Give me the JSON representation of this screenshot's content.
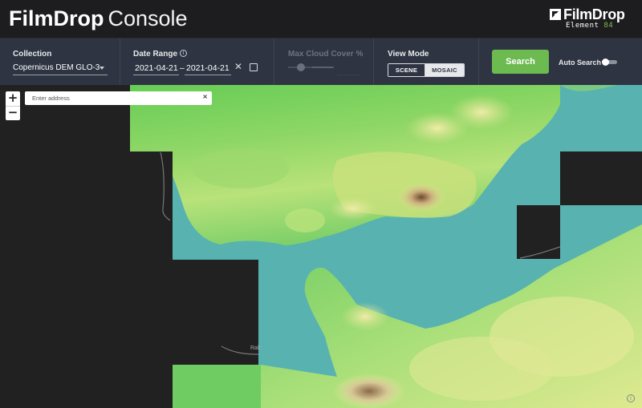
{
  "header": {
    "title_bold": "FilmDrop",
    "title_light": "Console",
    "brand_name": "FilmDrop",
    "brand_sub_word": "Element",
    "brand_sub_num": "84"
  },
  "toolbar": {
    "collection": {
      "label": "Collection",
      "value": "Copernicus DEM GLO-3"
    },
    "date_range": {
      "label": "Date Range",
      "start": "2021-04-21",
      "separator": "–",
      "end": "2021-04-21"
    },
    "cloud_cover": {
      "label": "Max Cloud Cover %",
      "disabled": true
    },
    "view_mode": {
      "label": "View Mode",
      "options": [
        "SCENE",
        "MOSAIC"
      ],
      "selected": "MOSAIC"
    },
    "search_label": "Search",
    "auto_search": {
      "label": "Auto Search",
      "enabled": false
    }
  },
  "map": {
    "zoom_in": "+",
    "zoom_out": "−",
    "address_placeholder": "Enter address",
    "address_clear": "×",
    "place_label": "Rab",
    "info_glyph": "i"
  },
  "colors": {
    "header_bg": "#1d1d1f",
    "toolbar_bg": "#2e3442",
    "accent_green": "#6cba50",
    "sea": "#58b2b0",
    "no_data": "#212121"
  },
  "icons": [
    "info-icon",
    "clear-icon",
    "calendar-icon",
    "chevron-down-icon",
    "brand-logo-icon"
  ]
}
